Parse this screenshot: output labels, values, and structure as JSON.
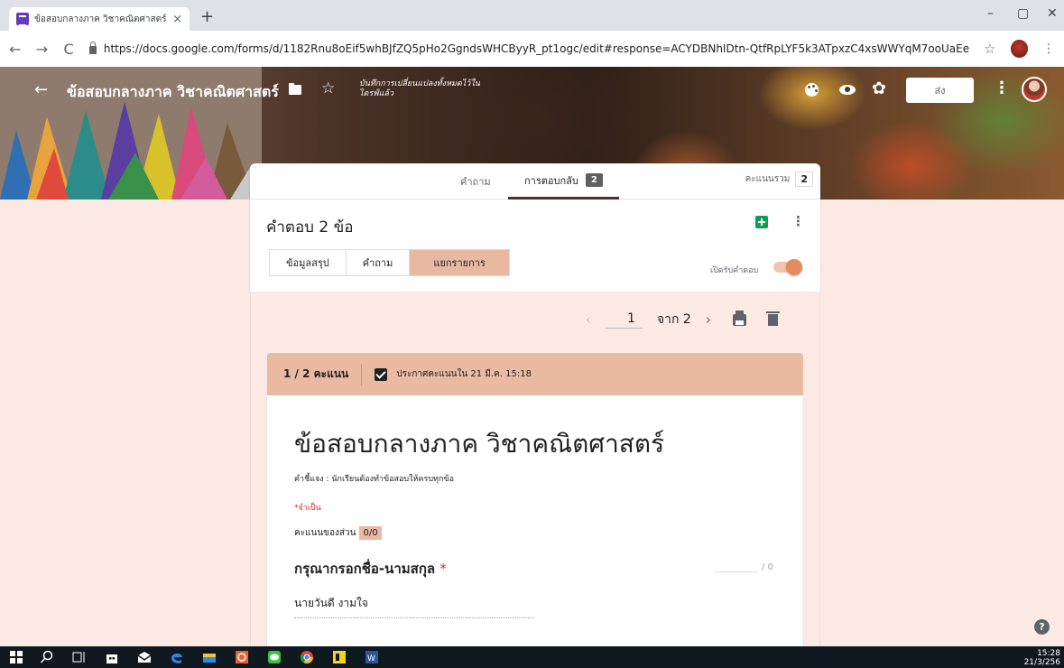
{
  "browser": {
    "tab_title": "ข้อสอบกลางภาค วิชาคณิตศาสตร์ - G",
    "tab_close": "×",
    "new_tab": "+",
    "url": "https://docs.google.com/forms/d/1182Rnu8oEif5whBJfZQ5pHo2GgndsWHCByyR_pt1ogc/edit#response=ACYDBNhIDtn-QtfRpLYF5k3ATpxzC4xsWWYqM7ooUaEe",
    "minimize": "–",
    "restore": "▢",
    "close": "✕"
  },
  "header": {
    "form_title": "ข้อสอบกลางภาค วิชาคณิตศาสตร์",
    "saved_note": "บันทึกการเปลี่ยนแปลงทั้งหมดไว้ในไดรฟ์แล้ว",
    "send_label": "ส่ง"
  },
  "main_tabs": {
    "questions": "คำถาม",
    "responses": "การตอบกลับ",
    "responses_count": "2",
    "total_score_label": "คะแนนรวม",
    "total_score_value": "2"
  },
  "responses": {
    "heading": "คำตอบ 2 ข้อ",
    "views": [
      "ข้อมูลสรุป",
      "คำถาม",
      "แยกรายการ"
    ],
    "active_view": "แยกรายการ",
    "accepting_label": "เปิดรับคำตอบ"
  },
  "pager": {
    "current": "1",
    "of_label": "จาก",
    "total": "2"
  },
  "score_band": {
    "score": "1 / 2 คะแนน",
    "released": "ประกาศคะแนนใน 21 มี.ค. 15:18"
  },
  "response_card": {
    "quiz_title": "ข้อสอบกลางภาค วิชาคณิตศาสตร์",
    "instructions": "คำชี้แจง : นักเรียนต้องทำข้อสอบให้ครบทุกข้อ",
    "required_note": "*จำเป็น",
    "section_score_label": "คะแนนของส่วน",
    "section_score_value": "0/0",
    "question_title": "กรุณากรอกชื่อ-นามสกุล",
    "question_required": "*",
    "points": "/ 0",
    "answer": "นายวันดี งามใจ"
  },
  "taskbar": {
    "time": "15:28",
    "date": "21/3/256"
  },
  "colors": {
    "accent": "#e9b9a2",
    "page_background": "#fbe9e4",
    "required": "#d93025",
    "sheets": "#0f9d58"
  },
  "icons": [
    "list-icon",
    "back-arrow-icon",
    "folder-icon",
    "star-icon",
    "palette-icon",
    "eye-icon",
    "gear-icon",
    "more-vert-icon",
    "sheets-icon",
    "chevron-left-icon",
    "chevron-right-icon",
    "print-icon",
    "delete-icon",
    "checkbox-icon",
    "help-icon",
    "windows-icon",
    "search-icon"
  ]
}
